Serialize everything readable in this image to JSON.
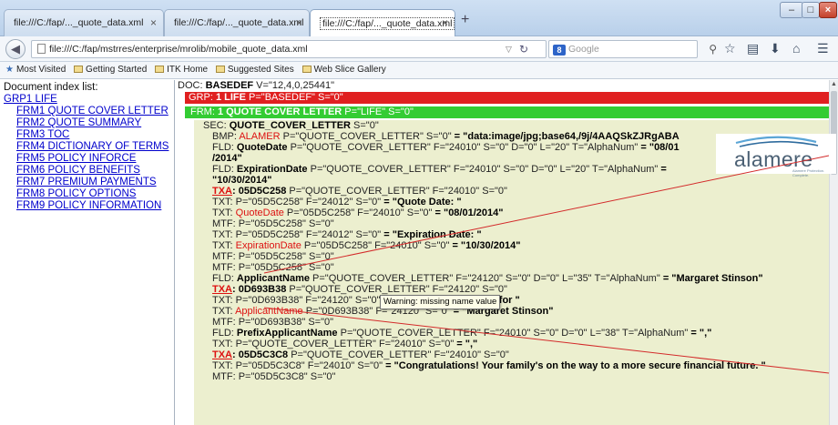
{
  "browser": {
    "tabs": [
      {
        "label": "file:///C:/fap/..._quote_data.xml",
        "active": false
      },
      {
        "label": "file:///C:/fap/..._quote_data.xml",
        "active": false
      },
      {
        "label": "file:///C:/fap/..._quote_data.xml",
        "active": true
      }
    ],
    "tab_close_glyph": "×",
    "new_tab_glyph": "+",
    "window_buttons": {
      "minimize": "–",
      "maximize": "□",
      "close": "×"
    },
    "url": "file:///C:/fap/mstrres/enterprise/mrolib/mobile_quote_data.xml",
    "search": {
      "engine": "8",
      "placeholder": "Google"
    },
    "bookmarks": [
      "Most Visited",
      "Getting Started",
      "ITK Home",
      "Suggested Sites",
      "Web Slice Gallery"
    ]
  },
  "index": {
    "title": "Document index list:",
    "group": "GRP1 LIFE",
    "forms": [
      "FRM1 QUOTE COVER LETTER",
      "FRM2 QUOTE SUMMARY",
      "FRM3 TOC",
      "FRM4 DICTIONARY OF TERMS",
      "FRM5 POLICY INFORCE",
      "FRM6 POLICY BENEFITS",
      "FRM7 PREMIUM PAYMENTS",
      "FRM8 POLICY OPTIONS",
      "FRM9 POLICY INFORMATION"
    ]
  },
  "tree": {
    "doc": {
      "prefix": "DOC: ",
      "name": "BASEDEF",
      "attrs": " V=\"12,4,0,25441\""
    },
    "grp": {
      "prefix": "GRP: ",
      "name": "1 LIFE",
      "attrs": " P=\"BASEDEF\" S=\"0\""
    },
    "frm": {
      "prefix": "FRM: ",
      "name": "1 QUOTE COVER LETTER",
      "attrs": " P=\"LIFE\" S=\"0\""
    },
    "sec": {
      "prefix": "SEC: ",
      "name": "QUOTE_COVER_LETTER",
      "attrs": " S=\"0\""
    },
    "lines": [
      {
        "tag": "BMP: ",
        "name": "ALAMER",
        "nameStyle": "red",
        "attrs": " P=\"QUOTE_COVER_LETTER\" S=\"0\"",
        "value": " = \"data:image/jpg;base64,/9j/4AAQSkZJRgABA"
      },
      {
        "tag": "FLD: ",
        "name": "QuoteDate",
        "nameStyle": "b",
        "attrs": " P=\"QUOTE_COVER_LETTER\" F=\"24010\" S=\"0\" D=\"0\" L=\"20\" T=\"AlphaNum\"",
        "value": " = \"08/01"
      },
      {
        "tag": "",
        "name": "",
        "nameStyle": "",
        "attrs": "",
        "value": "/2014\""
      },
      {
        "tag": "FLD: ",
        "name": "ExpirationDate",
        "nameStyle": "b",
        "attrs": " P=\"QUOTE_COVER_LETTER\" F=\"24010\" S=\"0\" D=\"0\" L=\"20\" T=\"AlphaNum\"",
        "value": " ="
      },
      {
        "tag": "",
        "name": "",
        "nameStyle": "",
        "attrs": "",
        "value": "\"10/30/2014\""
      },
      {
        "tag": "TXA",
        "tagStyle": "tx-under",
        "name": ": 05D5C258",
        "nameStyle": "b",
        "attrs": " P=\"QUOTE_COVER_LETTER\" F=\"24010\" S=\"0\"",
        "value": ""
      },
      {
        "tag": "TXT: ",
        "name": "",
        "nameStyle": "",
        "attrs": "P=\"05D5C258\" F=\"24012\" S=\"0\"",
        "value": " = \"Quote Date: \""
      },
      {
        "tag": "TXT: ",
        "name": "QuoteDate",
        "nameStyle": "red",
        "attrs": " P=\"05D5C258\" F=\"24010\" S=\"0\"",
        "value": " = \"08/01/2014\""
      },
      {
        "tag": "MTF: ",
        "name": "",
        "nameStyle": "",
        "attrs": "P=\"05D5C258\" S=\"0\"",
        "value": ""
      },
      {
        "tag": "TXT: ",
        "name": "",
        "nameStyle": "",
        "attrs": "P=\"05D5C258\" F=\"24012\" S=\"0\"",
        "value": " = \"Expiration Date: \""
      },
      {
        "tag": "TXT: ",
        "name": "ExpirationDate",
        "nameStyle": "red",
        "attrs": " P=\"05D5C258\" F=\"24010\" S=\"0\"",
        "value": " = \"10/30/2014\""
      },
      {
        "tag": "MTF: ",
        "name": "",
        "nameStyle": "",
        "attrs": "P=\"05D5C258\" S=\"0\"",
        "value": ""
      },
      {
        "tag": "MTF: ",
        "name": "",
        "nameStyle": "",
        "attrs": "P=\"05D5C258\" S=\"0\"",
        "value": ""
      },
      {
        "tag": "FLD: ",
        "name": "ApplicantName",
        "nameStyle": "b",
        "attrs": " P=\"QUOTE_COVER_LETTER\" F=\"24120\" S=\"0\" D=\"0\" L=\"35\" T=\"AlphaNum\"",
        "value": " = \"Margaret Stinson\""
      },
      {
        "tag": "TXA",
        "tagStyle": "tx-under",
        "name": ": 0D693B38",
        "nameStyle": "b",
        "attrs": " P=\"QUOTE_COVER_LETTER\" F=\"24120\" S=\"0\"",
        "value": ""
      },
      {
        "tag": "TXT: ",
        "name": "",
        "nameStyle": "",
        "attrs": "P=\"0D693B38\" F=\"24120\" S=\"0\"",
        "value": " = \"Life Insurance Quote for \""
      },
      {
        "tag": "TXT: ",
        "name": "ApplicantName",
        "nameStyle": "red",
        "attrs": " P=\"0D693B38\" F=\"24120\" S=\"0\"",
        "value": " = \"Margaret Stinson\""
      },
      {
        "tag": "MTF: ",
        "name": "",
        "nameStyle": "",
        "attrs": "P=\"0D693B38\" S=\"0\"",
        "value": ""
      },
      {
        "tag": "FLD: ",
        "name": "PrefixApplicantName",
        "nameStyle": "b",
        "attrs": " P=\"QUOTE_COVER_LETTER\" F=\"24010\" S=\"0\" D=\"0\" L=\"38\" T=\"AlphaNum\"",
        "value": " = \",\""
      },
      {
        "tag": "TXT: ",
        "name": "",
        "nameStyle": "",
        "attrs": "P=\"QUOTE_COVER_LETTER\" F=\"24010\" S=\"0\"",
        "value": " = \",\""
      },
      {
        "tag": "TXA",
        "tagStyle": "tx-under",
        "name": ": 05D5C3C8",
        "nameStyle": "b",
        "attrs": " P=\"QUOTE_COVER_LETTER\" F=\"24010\" S=\"0\"",
        "value": ""
      },
      {
        "tag": "TXT: ",
        "name": "",
        "nameStyle": "",
        "attrs": "P=\"05D5C3C8\" F=\"24010\" S=\"0\"",
        "value": " = \"Congratulations! Your family's on the way to a more secure financial future. \""
      },
      {
        "tag": "MTF: ",
        "name": "",
        "nameStyle": "",
        "attrs": "P=\"05D5C3C8\" S=\"0\"",
        "value": ""
      }
    ],
    "tooltip": "Warning: missing name value",
    "logo": {
      "word": "alamere",
      "tagline": "Alamere Protection. Complete."
    }
  }
}
